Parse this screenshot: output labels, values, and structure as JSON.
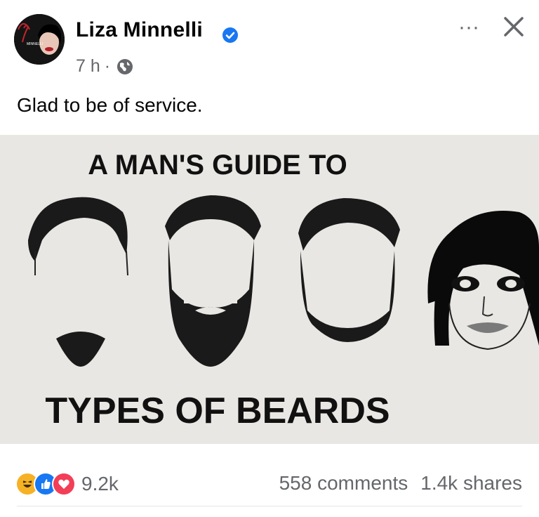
{
  "post": {
    "author": {
      "name": "Liza Minnelli",
      "avatar_text": "MINNELLI",
      "verified": true
    },
    "time": "7 h",
    "separator": "·",
    "audience_icon": "globe-icon",
    "caption": "Glad to be of service."
  },
  "image": {
    "title_top": "A MAN'S GUIDE TO",
    "title_bottom": "TYPES OF BEARDS"
  },
  "header_actions": {
    "more_icon": "more-horizontal-icon",
    "more_label": "···",
    "close_icon": "close-icon"
  },
  "footer": {
    "reaction_icons": [
      "haha-icon",
      "like-icon",
      "love-icon"
    ],
    "reaction_count": "9.2k",
    "comments": "558 comments",
    "shares": "1.4k shares"
  },
  "colors": {
    "verified_blue": "#1877f2",
    "like_blue": "#1877f2",
    "love_red": "#f33e58",
    "haha_yellow": "#f7b125",
    "secondary_text": "#65676b"
  }
}
